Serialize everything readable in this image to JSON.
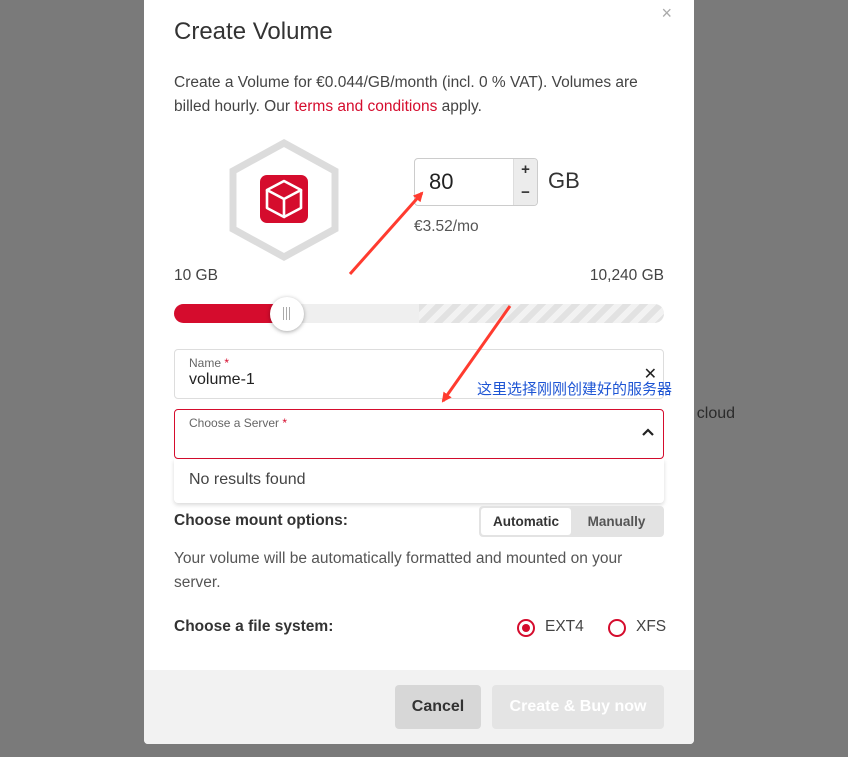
{
  "background": {
    "partial_text": "r cloud"
  },
  "modal": {
    "title": "Create Volume",
    "description_prefix": "Create a Volume for €0.044/GB/month (incl. 0 % VAT). Volumes are billed hourly. Our ",
    "terms_link": "terms and conditions",
    "description_suffix": " apply.",
    "close_icon": "close-icon"
  },
  "size": {
    "value": "80",
    "increment": "+",
    "decrement": "−",
    "unit": "GB",
    "price": "€3.52/mo",
    "min_label": "10 GB",
    "max_label": "10,240 GB",
    "slider_fraction": 0.23
  },
  "name_field": {
    "label": "Name",
    "required_mark": "*",
    "value": "volume-1"
  },
  "server_field": {
    "label": "Choose a Server",
    "required_mark": "*",
    "value": ""
  },
  "dropdown": {
    "empty_text": "No results found"
  },
  "mount": {
    "label": "Choose mount options:",
    "options": [
      "Automatic",
      "Manually"
    ],
    "selected": "Automatic",
    "description": "Your volume will be automatically formatted and mounted on your server."
  },
  "filesystem": {
    "label": "Choose a file system:",
    "options": [
      "EXT4",
      "XFS"
    ],
    "selected": "EXT4"
  },
  "footer": {
    "cancel_label": "Cancel",
    "create_label": "Create & Buy now"
  },
  "annotation": {
    "text": "这里选择刚刚创建好的服务器"
  },
  "colors": {
    "accent": "#d50c2d",
    "annotation": "#1e55d4",
    "arrow": "#ff3b2f"
  }
}
